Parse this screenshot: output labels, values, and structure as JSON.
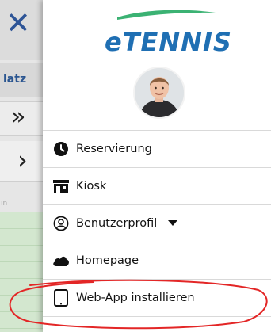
{
  "background": {
    "close_glyph": "✕",
    "tab_text": "latz",
    "double_chevron_glyph": "»",
    "single_chevron_glyph": "›",
    "hint_text": "in"
  },
  "drawer": {
    "logo_text": "eTENNIS",
    "menu": [
      {
        "label": "Reservierung",
        "icon": "clock-icon"
      },
      {
        "label": "Kiosk",
        "icon": "kiosk-store-icon"
      },
      {
        "label": "Benutzerprofil",
        "icon": "user-circle-icon",
        "has_dropdown": true
      },
      {
        "label": "Homepage",
        "icon": "cloud-icon"
      },
      {
        "label": "Web-App installieren",
        "icon": "tablet-icon"
      }
    ]
  },
  "colors": {
    "brand_blue": "#1f6fb3",
    "swoosh_green": "#3bb273",
    "annotation_red": "#e32626"
  }
}
